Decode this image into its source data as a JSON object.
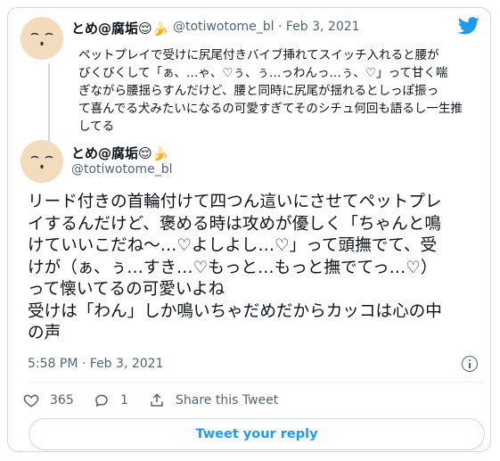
{
  "quoted_tweet": {
    "display_name": "とめ@腐垢",
    "name_emojis": "😌🍌",
    "handle": "@totiwotome_bl",
    "separator": "·",
    "date": "Feb 3, 2021",
    "text_lines": [
      "ペットプレイで受けに尻尾付きバイブ挿れてスイッチ入れると腰が",
      "びくびくして「ぁ、…ゃ、♡ぅ、ぅ…っわんっ…ぅ、♡」って甘く喘",
      "ぎながら腰揺らすんだけど、腰と同時に尻尾が揺れるとしっぽ振っ",
      "て喜んでる犬みたいになるの可愛すぎてそのシチュ何回も語るし一生推",
      "してる"
    ]
  },
  "main_tweet": {
    "display_name": "とめ@腐垢",
    "name_emojis": "😌🍌",
    "handle": "@totiwotome_bl",
    "text_lines": [
      "リード付きの首輪付けて四つん這いにさせてペットプレ",
      "イするんだけど、褒める時は攻めが優しく「ちゃんと鳴",
      "けていいこだね〜…♡よしよし…♡」って頭撫でて、受",
      "けが（ぁ、ぅ…すき…♡もっと…もっと撫でてっ…♡）",
      "って懐いてるの可愛いよね",
      "受けは「わん」しか鳴いちゃだめだからカッコは心の中",
      "の声"
    ],
    "time": "5:58 PM",
    "separator": "·",
    "date": "Feb 3, 2021"
  },
  "actions": {
    "like_count": "365",
    "reply_count": "1",
    "share_label": "Share this Tweet"
  },
  "reply_button_label": "Tweet your reply",
  "colors": {
    "twitter_blue": "#1d9bf0",
    "secondary_text": "#536471",
    "border": "#cfd9de"
  },
  "icons": [
    "twitter-bird-icon",
    "info-icon",
    "heart-icon",
    "reply-icon",
    "share-icon"
  ]
}
